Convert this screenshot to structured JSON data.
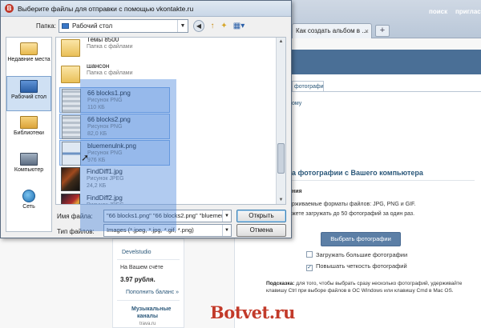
{
  "browser": {
    "tab_label": "Как создать альбом в ...",
    "tab_close": "×",
    "new_tab": "+",
    "nav": [
      "поиск",
      "приглас"
    ],
    "photos_tab": "фотографии",
    "breadcrumb": "ому",
    "upload_title": "а фотографии с Вашего компьютера",
    "upload_label": "ния",
    "upload_note_1": "рживаемые форматы файлов: JPG, PNG и GIF.",
    "upload_note_2": "жете загружать до 50 фотографий за один раз.",
    "choose_button": "Выбрать фотографии",
    "checkbox_1": "Загружать большие фотографии",
    "checkbox_2": "Повышать четкость фотографий",
    "checkbox_2_mark": "✓",
    "hint_bold": "Подсказка:",
    "hint_text": " для того, чтобы выбрать сразу несколько фотографий, удерживайте клавишу Ctrl при выборе файлов в ОС Windows или клавишу Cmd в Mac OS.",
    "left": {
      "devel": "Develstudio",
      "account": "На Вашем счёте",
      "amount": "3.97 рубля.",
      "topup": "Пополнить баланс »",
      "music_1": "Музыкальные",
      "music_2": "каналы",
      "music_site": "trava.ru"
    },
    "watermark": "Botvet.ru"
  },
  "dialog": {
    "title": "Выберите файлы для отправки с помощью vkontakte.ru",
    "title_icon": "В",
    "lookin_label": "Папка:",
    "lookin_value": "Рабочий стол",
    "toolbar": {
      "back": "◀",
      "up": "↑",
      "new_folder": "✦",
      "views": "▦▾"
    },
    "places": [
      {
        "label": "Недавние места",
        "icon": "recent-places-icon"
      },
      {
        "label": "Рабочий стол",
        "icon": "desktop-icon",
        "selected": true
      },
      {
        "label": "Библиотеки",
        "icon": "libraries-icon"
      },
      {
        "label": "Компьютер",
        "icon": "computer-icon"
      },
      {
        "label": "Сеть",
        "icon": "network-icon"
      }
    ],
    "files": [
      {
        "name": "Темы 8500",
        "type": "Папка с файлами",
        "size": "",
        "kind": "folder",
        "selected": false
      },
      {
        "name": "шансон",
        "type": "Папка с файлами",
        "size": "",
        "kind": "folder",
        "selected": false
      },
      {
        "name": "66 blocks1.png",
        "type": "Рисунок PNG",
        "size": "110 КБ",
        "kind": "png",
        "selected": true
      },
      {
        "name": "66 blocks2.png",
        "type": "Рисунок PNG",
        "size": "82,0 КБ",
        "kind": "png",
        "selected": true
      },
      {
        "name": "bluemenulnk.png",
        "type": "Рисунок PNG",
        "size": "976 КБ",
        "kind": "png-bar",
        "selected": true
      },
      {
        "name": "FindDiff1.jpg",
        "type": "Рисунок JPEG",
        "size": "24,2 КБ",
        "kind": "jpg1",
        "selected": false
      },
      {
        "name": "FindDiff2.jpg",
        "type": "Рисунок JPEG",
        "size": "",
        "kind": "jpg2",
        "selected": false
      }
    ],
    "filename_label": "Имя файла:",
    "filename_value": "\"66 blocks1.png\" \"66 blocks2.png\" \"bluemenu",
    "filetype_label": "Тип файлов:",
    "filetype_value": "Images (*.jpeg, *.jpg, *.gif, *.png)",
    "open_button": "Открыть",
    "cancel_button": "Отмена",
    "dropdown_arrow": "▼"
  }
}
